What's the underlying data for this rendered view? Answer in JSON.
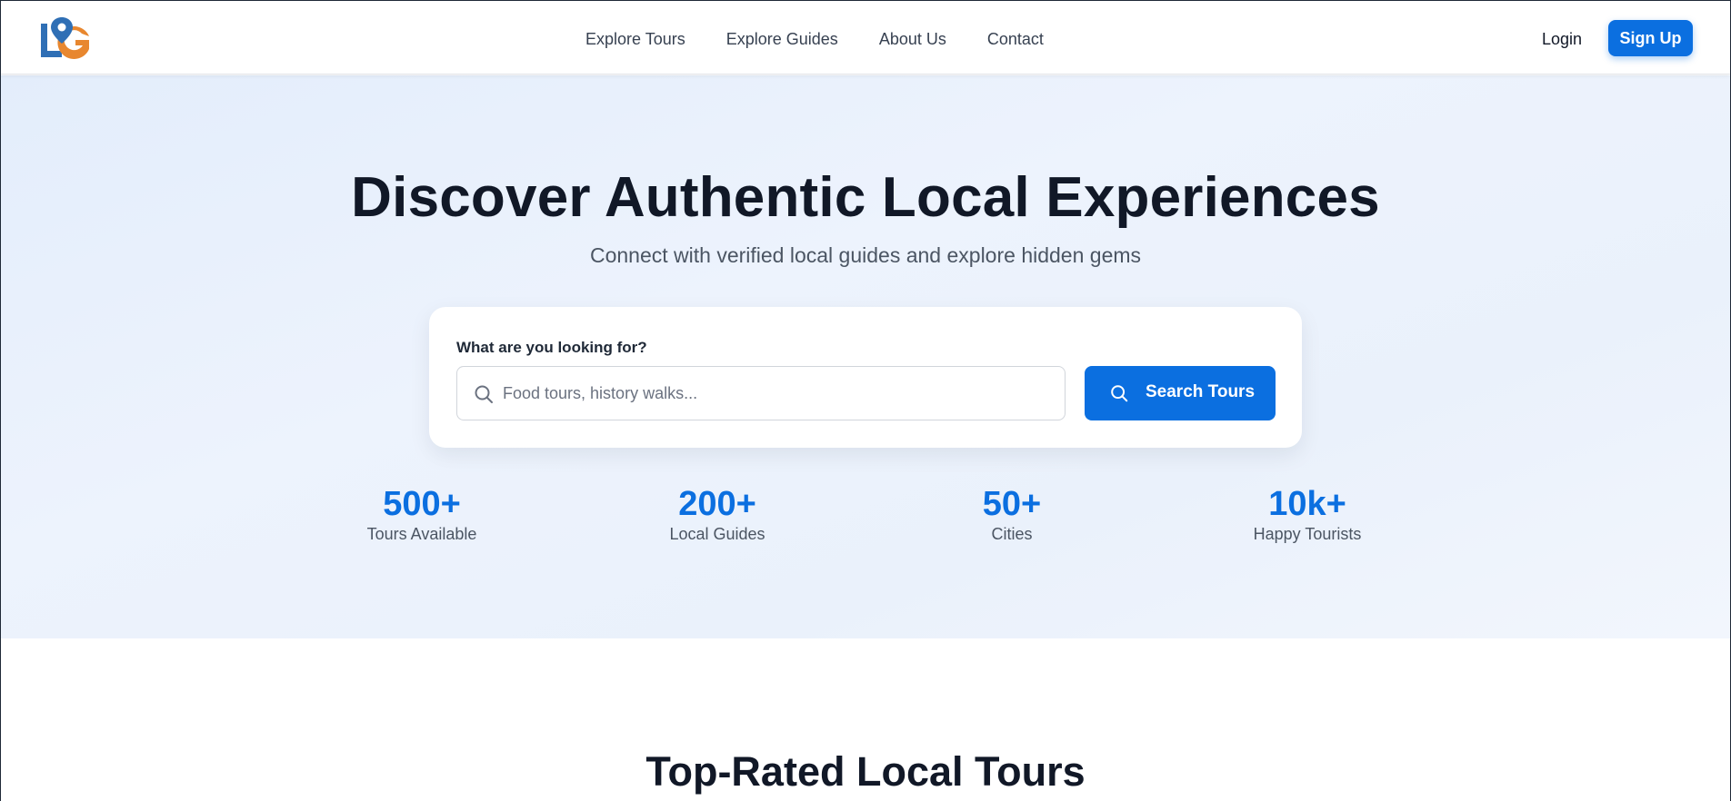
{
  "nav": {
    "links": [
      "Explore Tours",
      "Explore Guides",
      "About Us",
      "Contact"
    ],
    "login_label": "Login",
    "signup_label": "Sign Up"
  },
  "brand": {
    "logo_icon": "map-pin-lg-logo-icon",
    "primary_color": "#0b6fe0",
    "logo_blue": "#2f6fb5",
    "logo_orange": "#e8872f"
  },
  "hero": {
    "title": "Discover Authentic Local Experiences",
    "subtitle": "Connect with verified local guides and explore hidden gems",
    "search": {
      "label": "What are you looking for?",
      "placeholder": "Food tours, history walks...",
      "button_label": "Search Tours",
      "input_icon": "search-icon",
      "button_icon": "search-icon"
    },
    "stats": [
      {
        "value": "500+",
        "label": "Tours Available"
      },
      {
        "value": "200+",
        "label": "Local Guides"
      },
      {
        "value": "50+",
        "label": "Cities"
      },
      {
        "value": "10k+",
        "label": "Happy Tourists"
      }
    ]
  },
  "sections": {
    "top_rated_title": "Top-Rated Local Tours"
  }
}
